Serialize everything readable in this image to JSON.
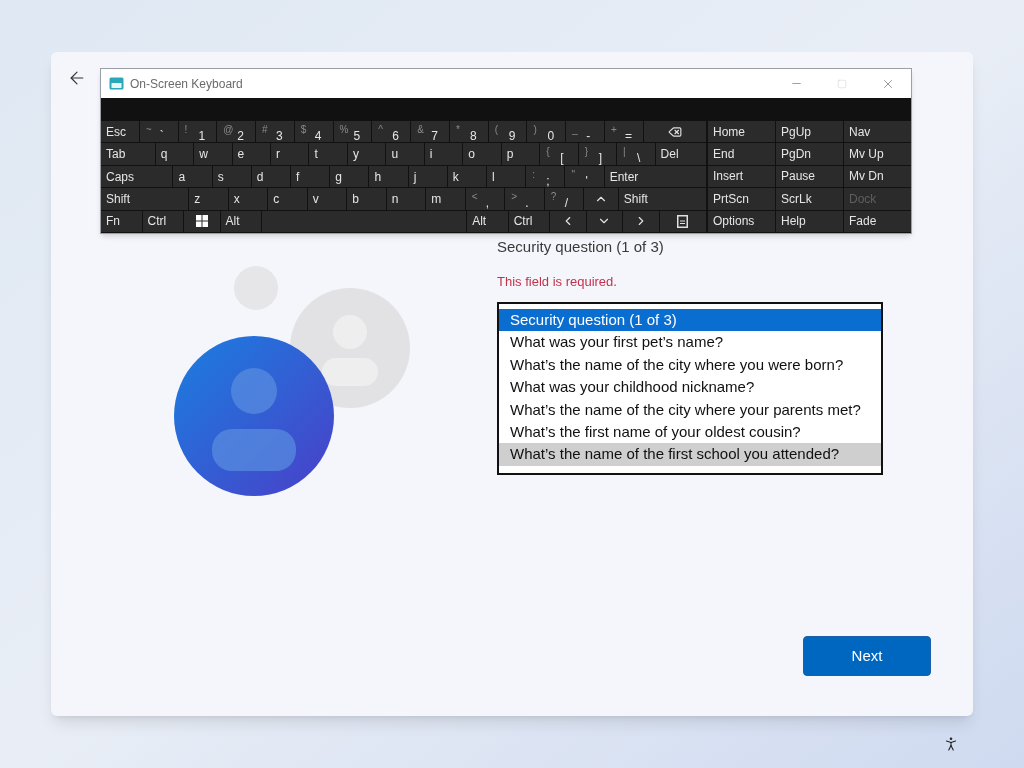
{
  "keyboard_window": {
    "title": "On-Screen Keyboard",
    "key_rows": [
      {
        "keys": [
          {
            "kind": "key",
            "label": "Esc"
          },
          {
            "kind": "key",
            "shift": "~",
            "label": "`"
          },
          {
            "kind": "key",
            "shift": "!",
            "label": "1"
          },
          {
            "kind": "key",
            "shift": "@",
            "label": "2"
          },
          {
            "kind": "key",
            "shift": "#",
            "label": "3"
          },
          {
            "kind": "key",
            "shift": "$",
            "label": "4"
          },
          {
            "kind": "key",
            "shift": "%",
            "label": "5"
          },
          {
            "kind": "key",
            "shift": "^",
            "label": "6"
          },
          {
            "kind": "key",
            "shift": "&",
            "label": "7"
          },
          {
            "kind": "key",
            "shift": "*",
            "label": "8"
          },
          {
            "kind": "key",
            "shift": "(",
            "label": "9"
          },
          {
            "kind": "key",
            "shift": ")",
            "label": "0"
          },
          {
            "kind": "key",
            "shift": "_",
            "label": "-"
          },
          {
            "kind": "key",
            "shift": "+",
            "label": "="
          },
          {
            "kind": "backspace"
          }
        ]
      },
      {
        "keys": [
          {
            "kind": "tab",
            "label": "Tab"
          },
          {
            "kind": "key",
            "label": "q"
          },
          {
            "kind": "key",
            "label": "w"
          },
          {
            "kind": "key",
            "label": "e"
          },
          {
            "kind": "key",
            "label": "r"
          },
          {
            "kind": "key",
            "label": "t"
          },
          {
            "kind": "key",
            "label": "y"
          },
          {
            "kind": "key",
            "label": "u"
          },
          {
            "kind": "key",
            "label": "i"
          },
          {
            "kind": "key",
            "label": "o"
          },
          {
            "kind": "key",
            "label": "p"
          },
          {
            "kind": "key",
            "shift": "{",
            "label": "["
          },
          {
            "kind": "key",
            "shift": "}",
            "label": "]"
          },
          {
            "kind": "key",
            "shift": "|",
            "label": "\\"
          },
          {
            "kind": "del",
            "label": "Del"
          }
        ]
      },
      {
        "keys": [
          {
            "kind": "caps",
            "label": "Caps"
          },
          {
            "kind": "key",
            "label": "a"
          },
          {
            "kind": "key",
            "label": "s"
          },
          {
            "kind": "key",
            "label": "d"
          },
          {
            "kind": "key",
            "label": "f"
          },
          {
            "kind": "key",
            "label": "g"
          },
          {
            "kind": "key",
            "label": "h"
          },
          {
            "kind": "key",
            "label": "j"
          },
          {
            "kind": "key",
            "label": "k"
          },
          {
            "kind": "key",
            "label": "l"
          },
          {
            "kind": "key",
            "shift": ":",
            "label": ";"
          },
          {
            "kind": "key",
            "shift": "\"",
            "label": "'"
          },
          {
            "kind": "enter",
            "label": "Enter"
          }
        ]
      },
      {
        "keys": [
          {
            "kind": "shift",
            "label": "Shift"
          },
          {
            "kind": "key",
            "label": "z"
          },
          {
            "kind": "key",
            "label": "x"
          },
          {
            "kind": "key",
            "label": "c"
          },
          {
            "kind": "key",
            "label": "v"
          },
          {
            "kind": "key",
            "label": "b"
          },
          {
            "kind": "key",
            "label": "n"
          },
          {
            "kind": "key",
            "label": "m"
          },
          {
            "kind": "key",
            "shift": "<",
            "label": ","
          },
          {
            "kind": "key",
            "shift": ">",
            "label": "."
          },
          {
            "kind": "key",
            "shift": "?",
            "label": "/"
          },
          {
            "kind": "arrow-up"
          },
          {
            "kind": "shift",
            "label": "Shift"
          }
        ]
      },
      {
        "keys": [
          {
            "kind": "key",
            "label": "Fn"
          },
          {
            "kind": "key",
            "label": "Ctrl"
          },
          {
            "kind": "windows"
          },
          {
            "kind": "key",
            "label": "Alt"
          },
          {
            "kind": "space"
          },
          {
            "kind": "key",
            "label": "Alt"
          },
          {
            "kind": "key",
            "label": "Ctrl"
          },
          {
            "kind": "arrow-left"
          },
          {
            "kind": "arrow-down"
          },
          {
            "kind": "arrow-right"
          },
          {
            "kind": "menu"
          }
        ]
      }
    ],
    "nav_keys": [
      {
        "label": "Home",
        "disabled": false
      },
      {
        "label": "PgUp",
        "disabled": false
      },
      {
        "label": "Nav",
        "disabled": false
      },
      {
        "label": "End",
        "disabled": false
      },
      {
        "label": "PgDn",
        "disabled": false
      },
      {
        "label": "Mv Up",
        "disabled": false
      },
      {
        "label": "Insert",
        "disabled": false
      },
      {
        "label": "Pause",
        "disabled": false
      },
      {
        "label": "Mv Dn",
        "disabled": false
      },
      {
        "label": "PrtScn",
        "disabled": false
      },
      {
        "label": "ScrLk",
        "disabled": false
      },
      {
        "label": "Dock",
        "disabled": true
      },
      {
        "label": "Options",
        "disabled": false
      },
      {
        "label": "Help",
        "disabled": false
      },
      {
        "label": "Fade",
        "disabled": false
      }
    ]
  },
  "form": {
    "label": "Security question (1 of 3)",
    "error": "This field is required.",
    "options": [
      {
        "text": "Security question (1 of 3)",
        "selected": true,
        "hovered": false
      },
      {
        "text": "What was your first pet’s name?",
        "selected": false,
        "hovered": false
      },
      {
        "text": "What’s the name of the city where you were born?",
        "selected": false,
        "hovered": false
      },
      {
        "text": "What was your childhood nickname?",
        "selected": false,
        "hovered": false
      },
      {
        "text": "What’s the name of the city where your parents met?",
        "selected": false,
        "hovered": false
      },
      {
        "text": "What’s the first name of your oldest cousin?",
        "selected": false,
        "hovered": false
      },
      {
        "text": "What’s the name of the first school you attended?",
        "selected": false,
        "hovered": true
      }
    ]
  },
  "next_button": "Next"
}
